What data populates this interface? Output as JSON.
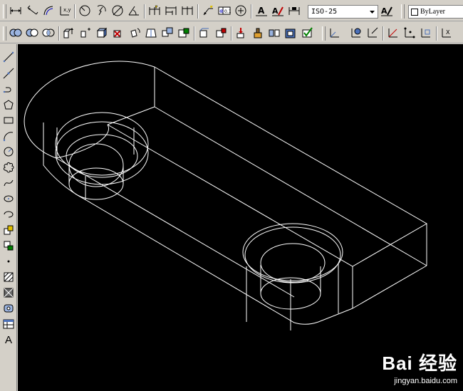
{
  "toolbars": {
    "dimension_style_combo": {
      "value": "ISO-25"
    },
    "layer_combo": {
      "value": "ByLayer"
    }
  },
  "draw_toolbar": {
    "text_tool_label": "A"
  },
  "colors": {
    "canvas_background": "#000000",
    "wireframe": "#ffffff",
    "toolbar_face": "#d4d0c8",
    "accent_blue": "#0000c0"
  },
  "watermark": {
    "brand": "Bai 经验",
    "url": "jingyan.baidu.com"
  }
}
